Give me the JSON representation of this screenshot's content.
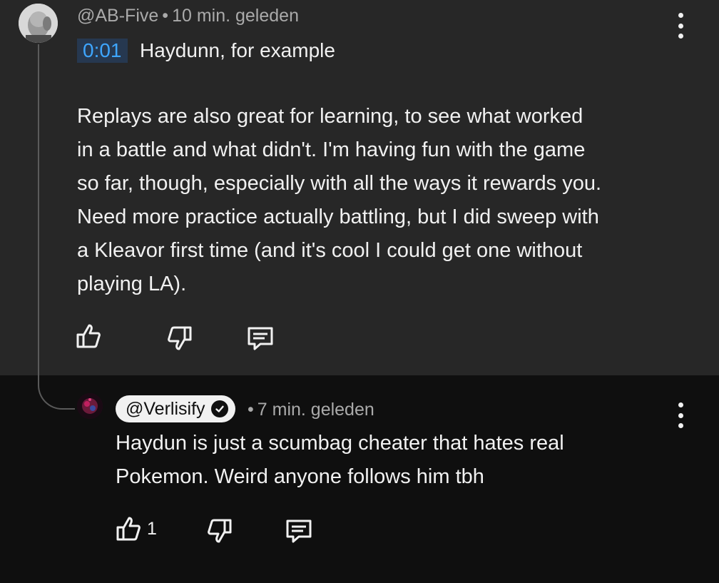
{
  "parent_comment": {
    "author": "@AB-Five",
    "separator": "•",
    "time_ago": "10 min. geleden",
    "timestamp_link": "0:01",
    "first_line": "Haydunn, for example",
    "body": "Replays are also great for learning, to see what worked\nin a battle and what didn't. I'm having fun with the game\nso far, though, especially with all the ways it rewards you.\nNeed more practice actually battling, but I did sweep with\na Kleavor first time (and it's cool I could get one without\nplaying LA).",
    "actions": {
      "like_icon": "thumb-up-icon",
      "dislike_icon": "thumb-down-icon",
      "reply_icon": "reply-icon"
    }
  },
  "reply_comment": {
    "author": "@Verlisify",
    "verified_icon": "verified-check-icon",
    "separator": "•",
    "time_ago": "7 min. geleden",
    "body": "Haydun is just a scumbag cheater that hates real\nPokemon. Weird anyone follows him tbh",
    "like_count": "1",
    "actions": {
      "like_icon": "thumb-up-icon",
      "dislike_icon": "thumb-down-icon",
      "reply_icon": "reply-icon"
    }
  },
  "colors": {
    "parent_background": "#272727",
    "reply_background": "#0f0f0f",
    "timestamp_link": "#3ea6ff",
    "timestamp_bg": "#263850",
    "meta_text": "#aaaaaa"
  }
}
